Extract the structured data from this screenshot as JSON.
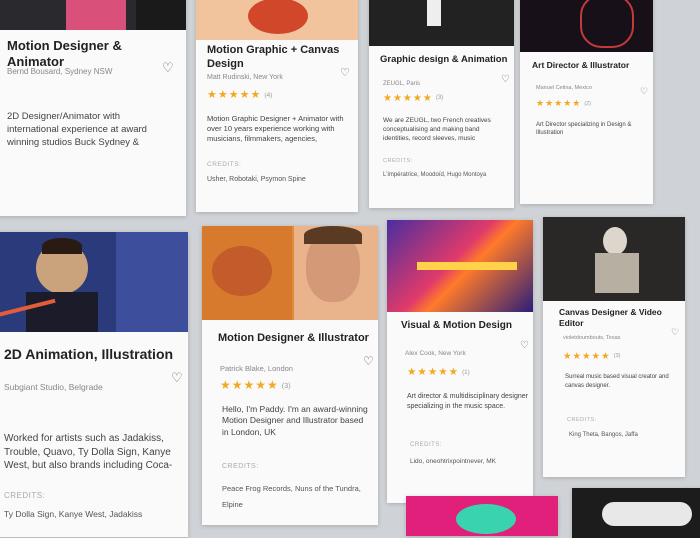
{
  "cards": [
    {
      "title": "Motion Designer & Animator",
      "author": "Bernd Bousard, Sydney NSW",
      "stars": "",
      "count": "",
      "description": "2D Designer/Animator with international experience at award winning studios Buck Sydney &",
      "credits_label": "",
      "credits": ""
    },
    {
      "title": "Motion Graphic + Canvas Design",
      "author": "Matt Rudinski, New York",
      "stars": "★★★★★",
      "count": "(4)",
      "description": "Motion Graphic Designer + Animator with over 10 years experience working with musicians, filmmakers, agencies,",
      "credits_label": "CREDITS:",
      "credits": "Usher, Robotaki, Psymon Spine"
    },
    {
      "title": "Graphic design & Animation",
      "author": "ZEUGL, Paris",
      "stars": "★★★★★",
      "count": "(3)",
      "description": "We are ZEUGL, two French creatives conceptualising and making band identities, record sleeves, music",
      "credits_label": "CREDITS:",
      "credits": "L'impératrice, Moodoïd, Hugo Montoya"
    },
    {
      "title": "Art Director & Illustrator",
      "author": "Manuel Cetina, Mexico",
      "stars": "★★★★★",
      "count": "(2)",
      "description": "Art Director specializing in Design & Illustration",
      "credits_label": "",
      "credits": ""
    },
    {
      "title": "2D Animation, Illustration",
      "author": "Subgiant Studio, Belgrade",
      "stars": "",
      "count": "",
      "description": "Worked for artists such as Jadakiss, Trouble, Quavo, Ty Dolla Sign, Kanye West, but also brands including Coca-",
      "credits_label": "CREDITS:",
      "credits": "Ty Dolla Sign, Kanye West, Jadakiss"
    },
    {
      "title": "Motion Designer & Illustrator",
      "author": "Patrick Blake, London",
      "stars": "★★★★★",
      "count": "(3)",
      "description": "Hello, I'm Paddy. I'm an award-winning Motion Designer and Illustrator based in London, UK",
      "credits_label": "CREDITS:",
      "credits": "Peace Frog Records, Nuns of the Tundra, Elpine"
    },
    {
      "title": "Visual & Motion Design",
      "author": "Alex Cook, New York",
      "stars": "★★★★★",
      "count": "(1)",
      "description": "Art director & multidisciplinary designer specializing in the music space.",
      "credits_label": "CREDITS:",
      "credits": "Lido, oneohtrixpointnever, MK"
    },
    {
      "title": "Canvas Designer & Video Editor",
      "author": "violetdoumbouts, Texas",
      "stars": "★★★★★",
      "count": "(3)",
      "description": "Surreal music based visual creator and canvas designer.",
      "credits_label": "CREDITS:",
      "credits": "King Theta, Bangos, Jaffa"
    }
  ],
  "colors": {
    "star": "#f2a81f",
    "page_bg": "#cfd2d6",
    "card_bg": "#fafafa"
  },
  "icons": {
    "favorite": "heart-icon"
  }
}
